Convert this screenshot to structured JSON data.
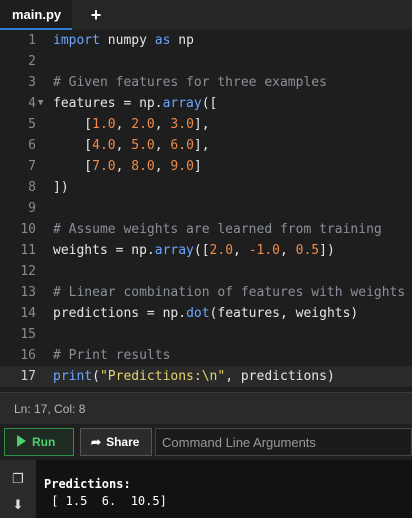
{
  "tabs": {
    "active_file": "main.py",
    "add_label": "+"
  },
  "editor": {
    "lines": [
      {
        "n": "1"
      },
      {
        "n": "2"
      },
      {
        "n": "3"
      },
      {
        "n": "4"
      },
      {
        "n": "5"
      },
      {
        "n": "6"
      },
      {
        "n": "7"
      },
      {
        "n": "8"
      },
      {
        "n": "9"
      },
      {
        "n": "10"
      },
      {
        "n": "11"
      },
      {
        "n": "12"
      },
      {
        "n": "13"
      },
      {
        "n": "14"
      },
      {
        "n": "15"
      },
      {
        "n": "16"
      },
      {
        "n": "17"
      }
    ],
    "code": {
      "l1": [
        "import",
        " numpy ",
        "as",
        " np"
      ],
      "l3": "# Given features for three examples",
      "l4": [
        "features = np.",
        "array",
        "(["
      ],
      "l5": [
        "    [",
        "1.0",
        ", ",
        "2.0",
        ", ",
        "3.0",
        "],"
      ],
      "l6": [
        "    [",
        "4.0",
        ", ",
        "5.0",
        ", ",
        "6.0",
        "],"
      ],
      "l7": [
        "    [",
        "7.0",
        ", ",
        "8.0",
        ", ",
        "9.0",
        "]"
      ],
      "l8": "])",
      "l10": "# Assume weights are learned from training",
      "l11": [
        "weights = np.",
        "array",
        "([",
        "2.0",
        ", ",
        "-1.0",
        ", ",
        "0.5",
        "])"
      ],
      "l13": "# Linear combination of features with weights",
      "l14": [
        "predictions = np.",
        "dot",
        "(features, weights)"
      ],
      "l16": "# Print results",
      "l17": [
        "print",
        "(",
        "\"Predictions:\\n\"",
        ", predictions)"
      ]
    }
  },
  "status": {
    "text": "Ln: 17,  Col: 8"
  },
  "toolbar": {
    "run_label": "Run",
    "share_label": "Share",
    "args_placeholder": "Command Line Arguments"
  },
  "output": {
    "line1": "Predictions:",
    "line2": " [ 1.5  6.  10.5]"
  },
  "icons": {
    "copy": "copy-icon",
    "download": "download-icon"
  },
  "colors": {
    "accent": "#2e7bd6",
    "run": "#4fd06c",
    "keyword": "#6aa7ff",
    "number": "#f08b4b",
    "comment": "#8a8f98",
    "string": "#e6d46f"
  }
}
